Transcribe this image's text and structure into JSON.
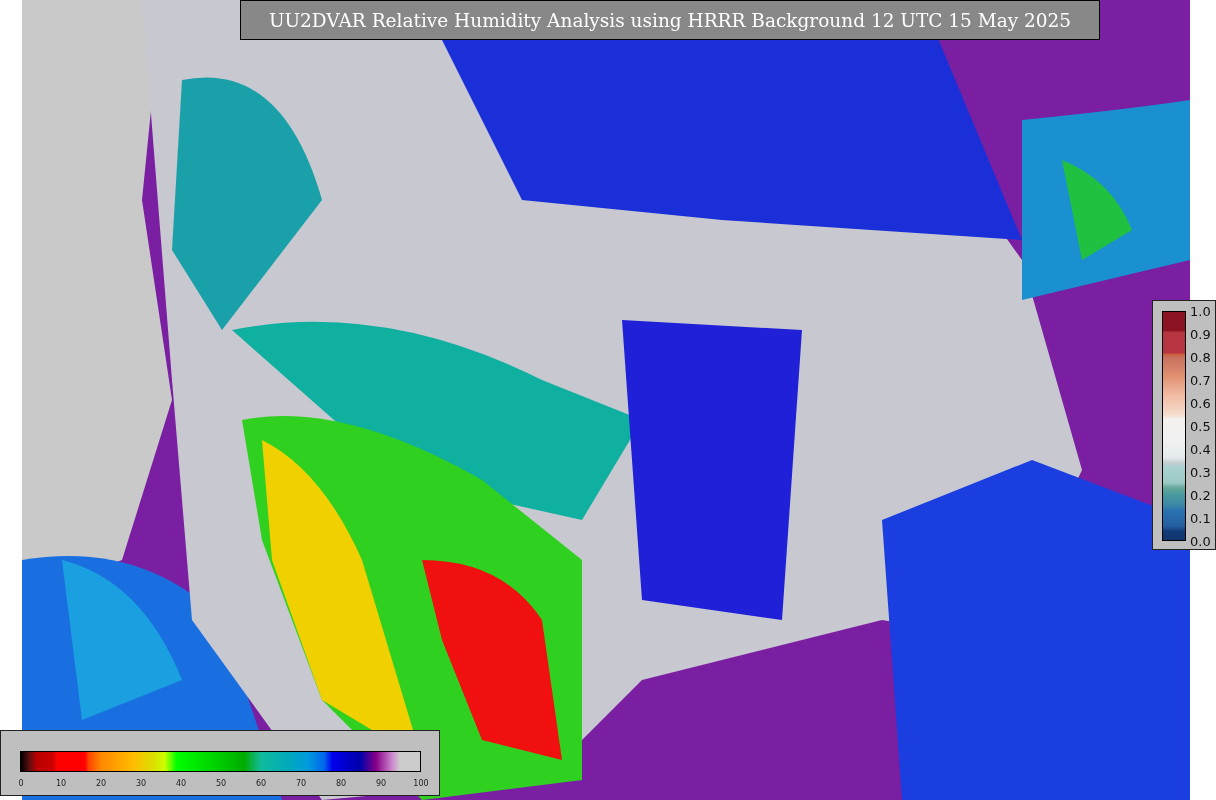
{
  "title": "UU2DVAR Relative Humidity Analysis using HRRR Background 12 UTC 15 May 2025",
  "humidity_colorbar": {
    "tick_labels": [
      "0",
      "10",
      "20",
      "30",
      "40",
      "50",
      "60",
      "70",
      "80",
      "90",
      "100"
    ]
  },
  "observation_colorbar": {
    "tick_labels": [
      "1.0",
      "0.9",
      "0.8",
      "0.7",
      "0.6",
      "0.5",
      "0.4",
      "0.3",
      "0.2",
      "0.1",
      "0.0"
    ]
  }
}
